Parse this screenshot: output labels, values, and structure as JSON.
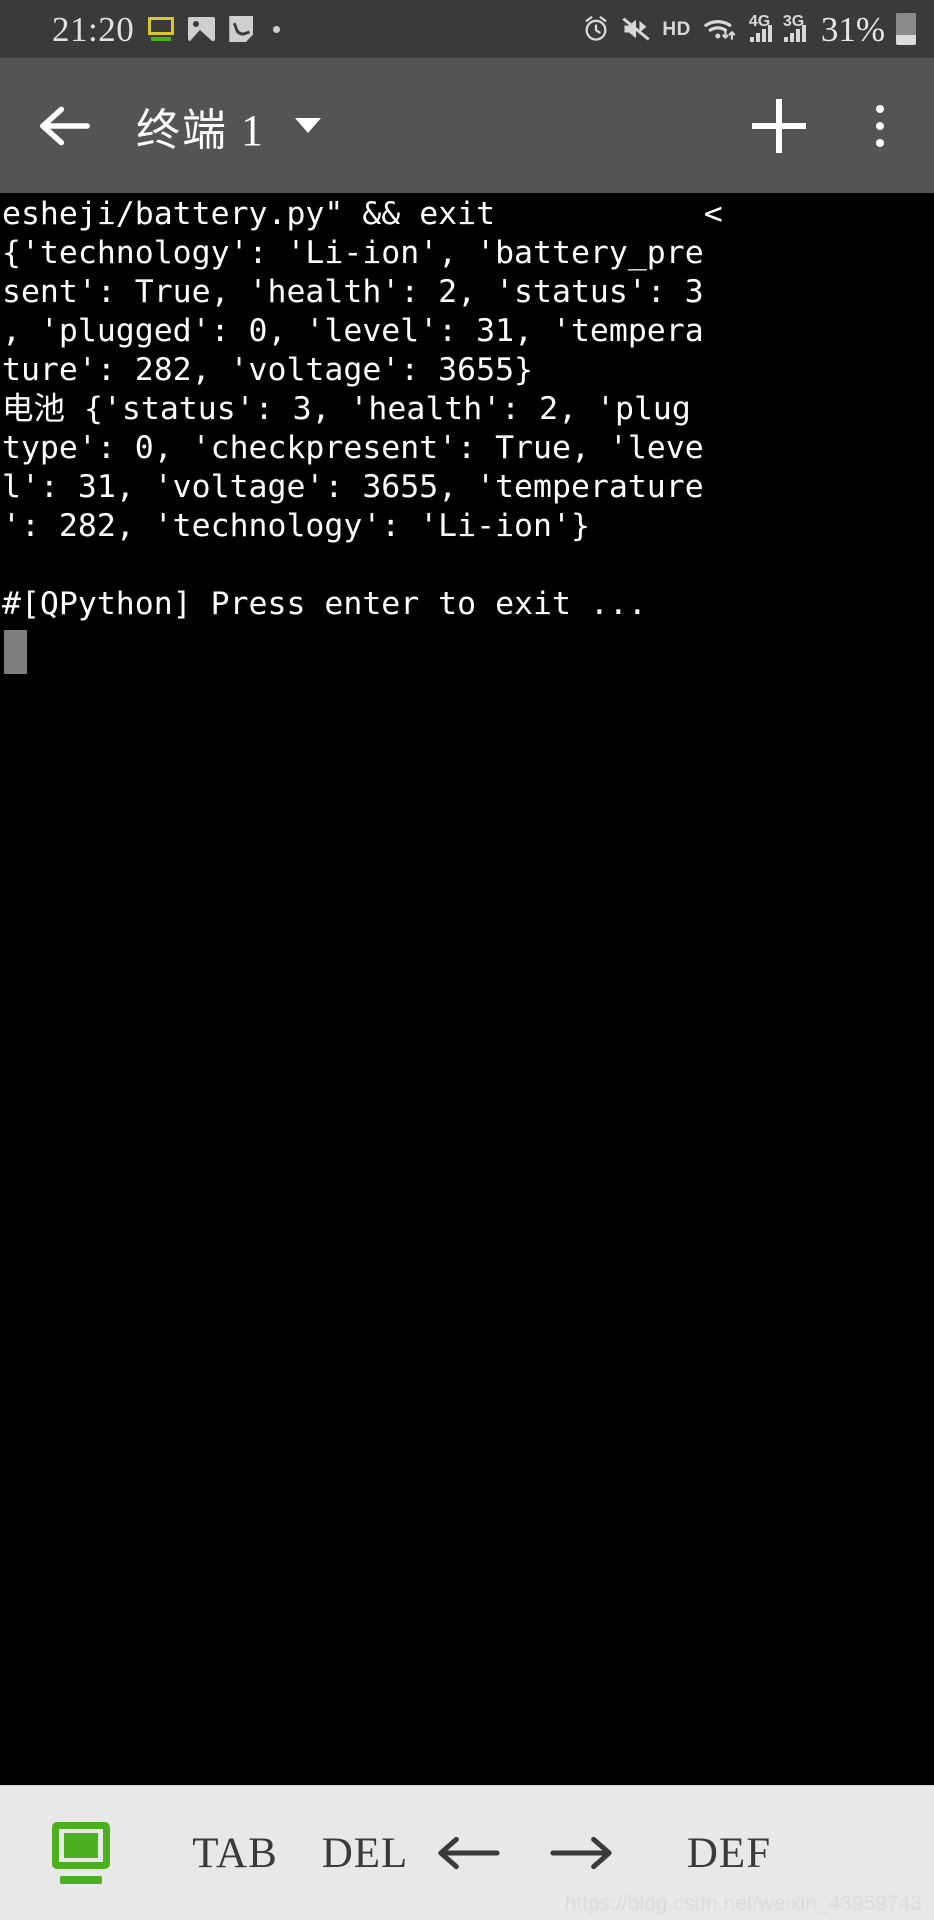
{
  "status_bar": {
    "time": "21:20",
    "battery_percent": "31%",
    "hd_label": "HD",
    "network_4g": "4G",
    "network_3g": "3G",
    "icons": [
      "screen-cast-icon",
      "photo-icon",
      "note-icon",
      "dot-icon",
      "alarm-icon",
      "mute-icon",
      "hd-icon",
      "wifi-icon",
      "signal-4g-icon",
      "signal-3g-icon",
      "battery-icon"
    ],
    "colors": {
      "background": "#3a3a3a",
      "text": "#e2e2e2",
      "screen_icon_border": "#d8c72a",
      "screen_icon_base": "#4caf20"
    }
  },
  "app_bar": {
    "back_label": "←",
    "title": "终端 1",
    "dropdown_label": "▾",
    "add_label": "+",
    "overflow_label": "⋮",
    "background": "#545454"
  },
  "terminal": {
    "background": "#000000",
    "foreground": "#ffffff",
    "lines": [
      "esheji/battery.py\" && exit           <",
      "{'technology': 'Li-ion', 'battery_pre",
      "sent': True, 'health': 2, 'status': 3",
      ", 'plugged': 0, 'level': 31, 'tempera",
      "ture': 282, 'voltage': 3655}",
      "电池 {'status': 3, 'health': 2, 'plug",
      "type': 0, 'checkpresent': True, 'leve",
      "l': 31, 'voltage': 3655, 'temperature",
      "': 282, 'technology': 'Li-ion'}",
      "",
      "#[QPython] Press enter to exit ..."
    ],
    "cursor_color": "#7d7d7d"
  },
  "bottom_bar": {
    "background": "#e8e8e8",
    "keyboard_icon_color": "#4caf20",
    "buttons": [
      {
        "name": "keyboard-toggle",
        "label": ""
      },
      {
        "name": "tab-key",
        "label": "TAB"
      },
      {
        "name": "del-key",
        "label": "DEL"
      },
      {
        "name": "left-arrow-key",
        "label": "←"
      },
      {
        "name": "right-arrow-key",
        "label": "→"
      },
      {
        "name": "def-key",
        "label": "DEF"
      }
    ],
    "watermark": "https://blog.csdn.net/weixin_43959743"
  }
}
